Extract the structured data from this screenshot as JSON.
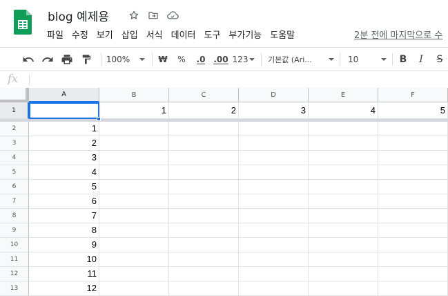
{
  "document": {
    "title": "blog 예제용"
  },
  "header_icons": [
    "star-icon",
    "move-to-folder-icon",
    "cloud-status-icon"
  ],
  "menu": [
    "파일",
    "수정",
    "보기",
    "삽입",
    "서식",
    "데이터",
    "도구",
    "부가기능",
    "도움말"
  ],
  "last_edit": "2분 전에 마지막으로 수",
  "toolbar": {
    "zoom": "100%",
    "currency": "₩",
    "percent": "%",
    "decrease_decimals": ".0",
    "increase_decimals": ".00",
    "number_format": "123",
    "font_family": "기본값 (Ari...",
    "font_size": "10",
    "bold": "B",
    "italic": "I",
    "strikethrough": "S"
  },
  "formula_bar": {
    "fx_label": "fx",
    "value": ""
  },
  "grid": {
    "columns": [
      "A",
      "B",
      "C",
      "D",
      "E",
      "F"
    ],
    "rows": [
      "1",
      "2",
      "3",
      "4",
      "5",
      "6",
      "7",
      "8",
      "9",
      "10",
      "11",
      "12",
      "13"
    ],
    "row1": [
      "",
      "1",
      "2",
      "3",
      "4",
      "5"
    ],
    "column_a": [
      "1",
      "2",
      "3",
      "4",
      "5",
      "6",
      "7",
      "8",
      "9",
      "10",
      "11",
      "12"
    ],
    "selected_cell": "A1"
  },
  "colors": {
    "accent": "#1a73e8",
    "sheets_green": "#0f9d58"
  }
}
